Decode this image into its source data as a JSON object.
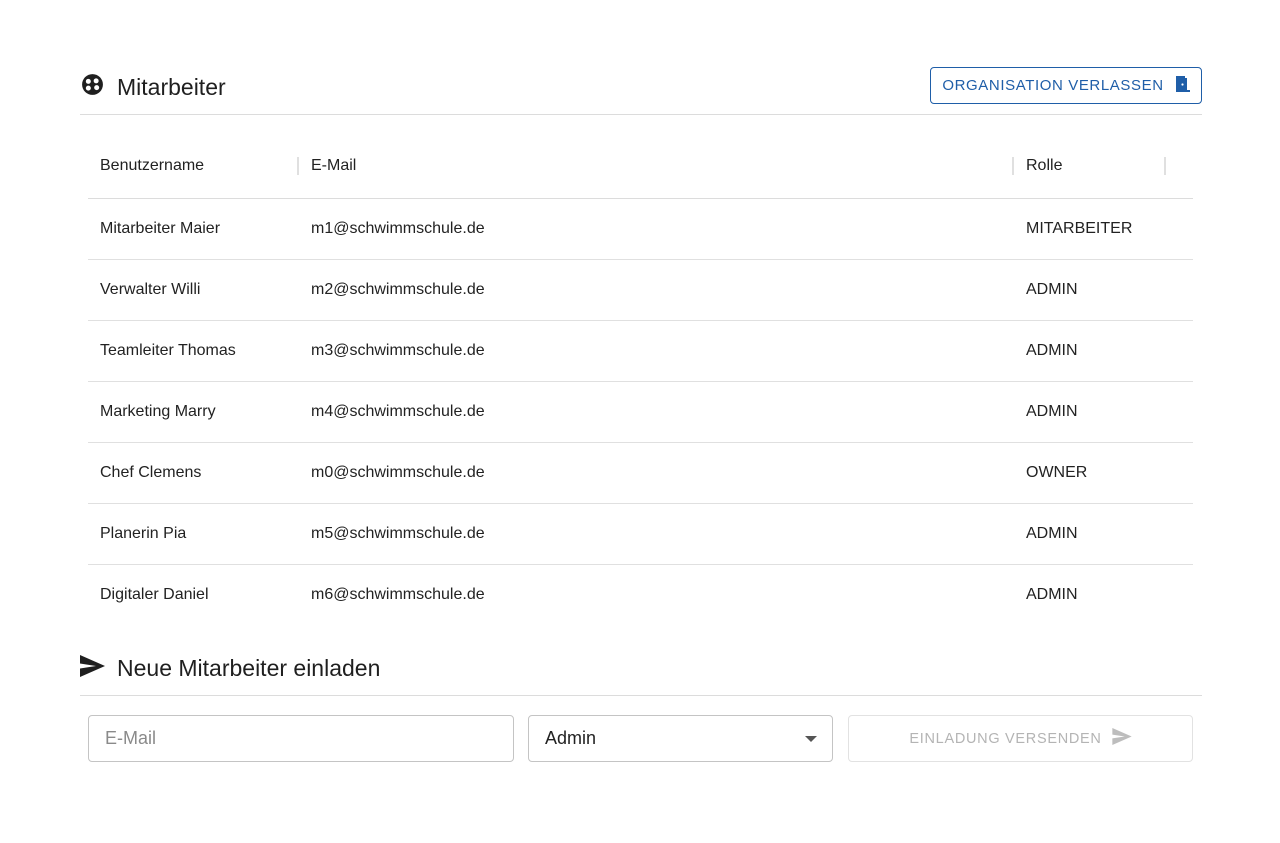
{
  "staff_section": {
    "title": "Mitarbeiter",
    "icon": "palette-icon",
    "leave_button_label": "ORGANISATION VERLASSEN",
    "leave_button_icon": "door-exit-icon"
  },
  "table": {
    "headers": {
      "username": "Benutzername",
      "email": "E-Mail",
      "role": "Rolle"
    },
    "rows": [
      {
        "username": "Mitarbeiter Maier",
        "email": "m1@schwimmschule.de",
        "role": "MITARBEITER"
      },
      {
        "username": "Verwalter Willi",
        "email": "m2@schwimmschule.de",
        "role": "ADMIN"
      },
      {
        "username": "Teamleiter Thomas",
        "email": "m3@schwimmschule.de",
        "role": "ADMIN"
      },
      {
        "username": "Marketing Marry",
        "email": "m4@schwimmschule.de",
        "role": "ADMIN"
      },
      {
        "username": "Chef Clemens",
        "email": "m0@schwimmschule.de",
        "role": "OWNER"
      },
      {
        "username": "Planerin Pia",
        "email": "m5@schwimmschule.de",
        "role": "ADMIN"
      },
      {
        "username": "Digitaler Daniel",
        "email": "m6@schwimmschule.de",
        "role": "ADMIN"
      }
    ]
  },
  "invite_section": {
    "title": "Neue Mitarbeiter einladen",
    "icon": "send-icon",
    "email_placeholder": "E-Mail",
    "email_value": "",
    "role_selected": "Admin",
    "send_button_label": "EINLADUNG VERSENDEN"
  },
  "colors": {
    "accent": "#1f5ea8",
    "divider": "#dcdcdc",
    "disabled_text": "#b4b4b4"
  }
}
